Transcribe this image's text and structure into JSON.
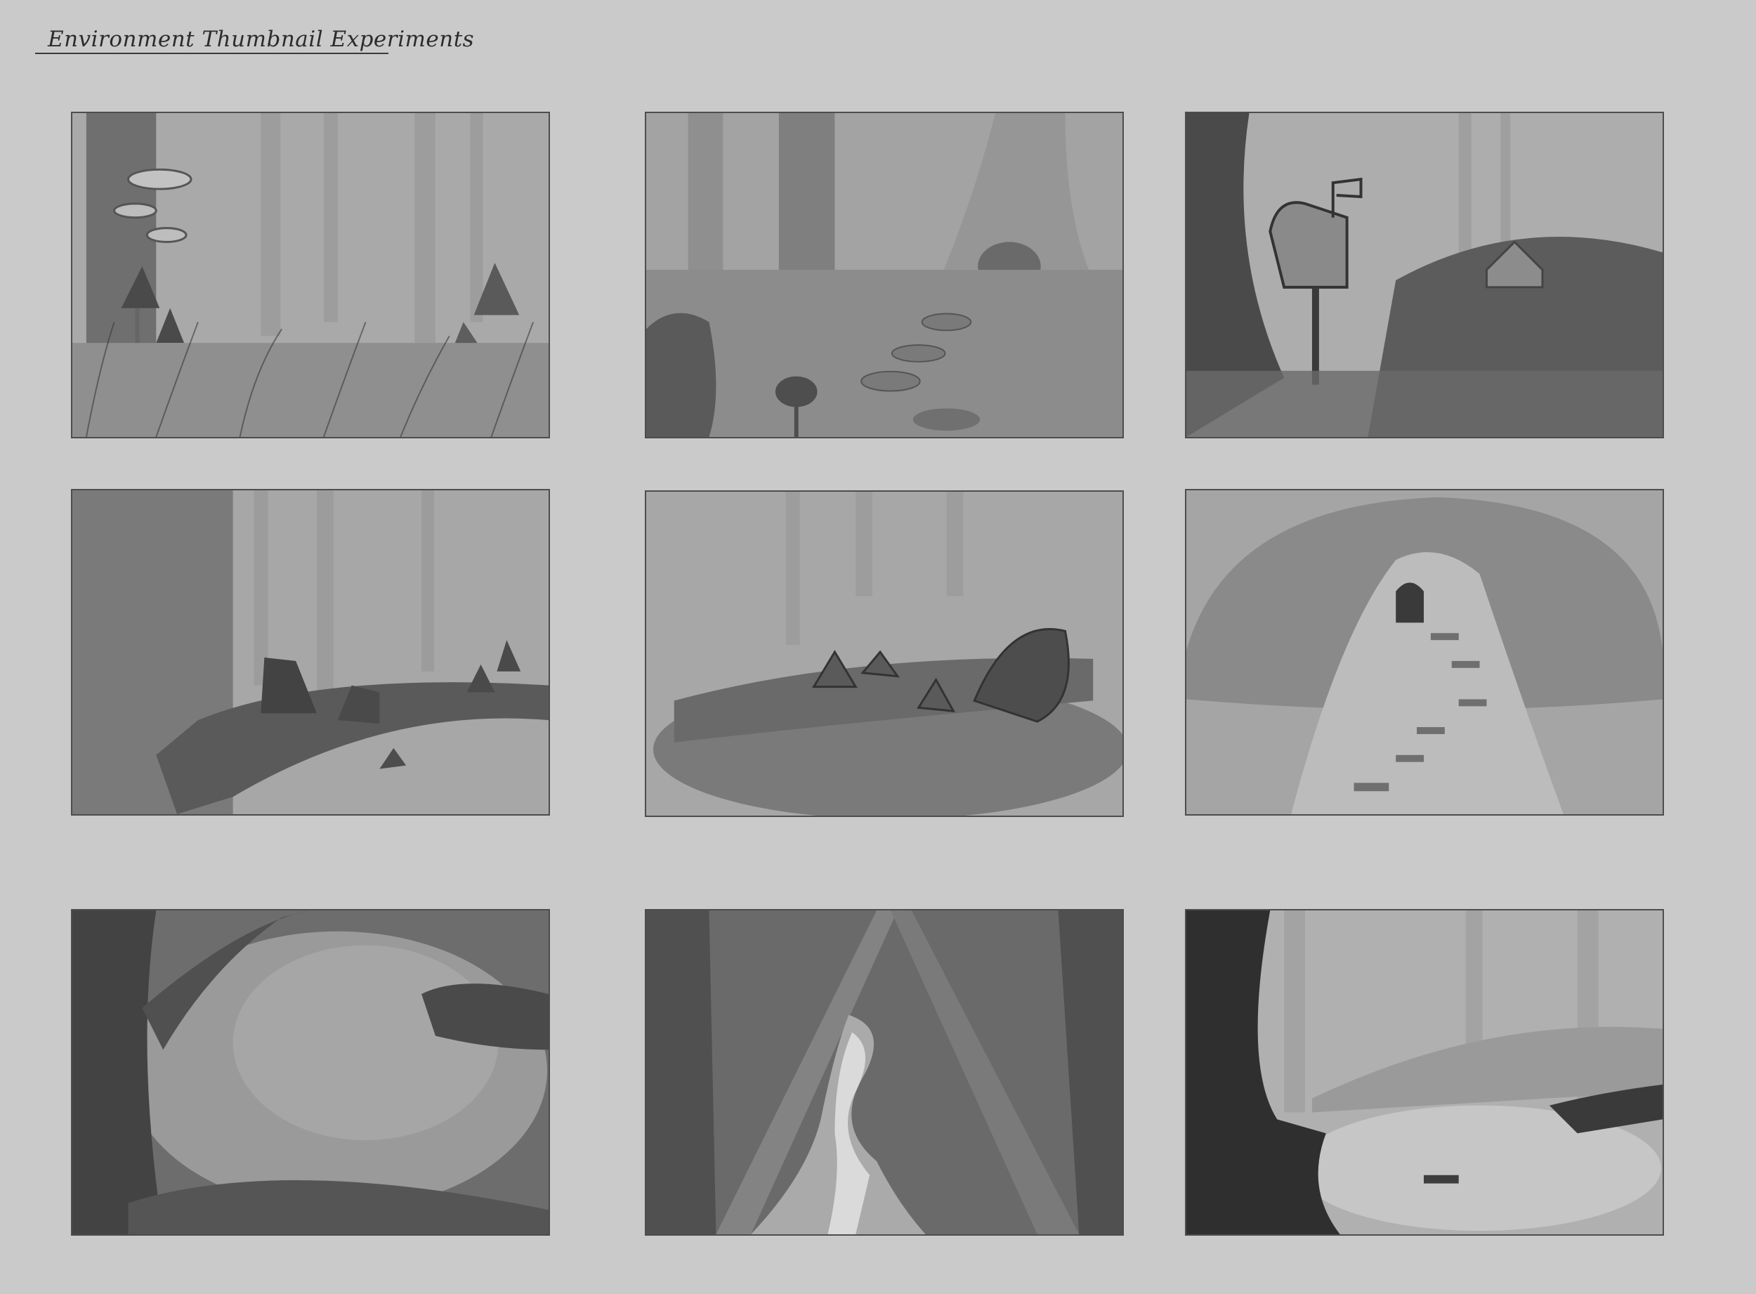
{
  "sheet": {
    "title": "Environment Thumbnail Experiments"
  },
  "thumbnails": [
    {
      "scene": "misty forest with shelf fungus on tree and mushrooms in grass"
    },
    {
      "scene": "forest path with stepping stones to a tree-root doorway"
    },
    {
      "scene": "mailbox in front of a small house on a hill"
    },
    {
      "scene": "dark mushrooms on a mossy log beside a large trunk"
    },
    {
      "scene": "cluster of mushrooms growing on a fallen log"
    },
    {
      "scene": "giant mushroom house with stairs and a door"
    },
    {
      "scene": "dark framing trees around a misty clearing"
    },
    {
      "scene": "glowing stream winding between tall trees"
    },
    {
      "scene": "forest pond with a dark tree in the foreground"
    }
  ],
  "palette": {
    "background": "#cacaca",
    "frame": "#4d4d4d",
    "ink": "#2c2c2c"
  }
}
